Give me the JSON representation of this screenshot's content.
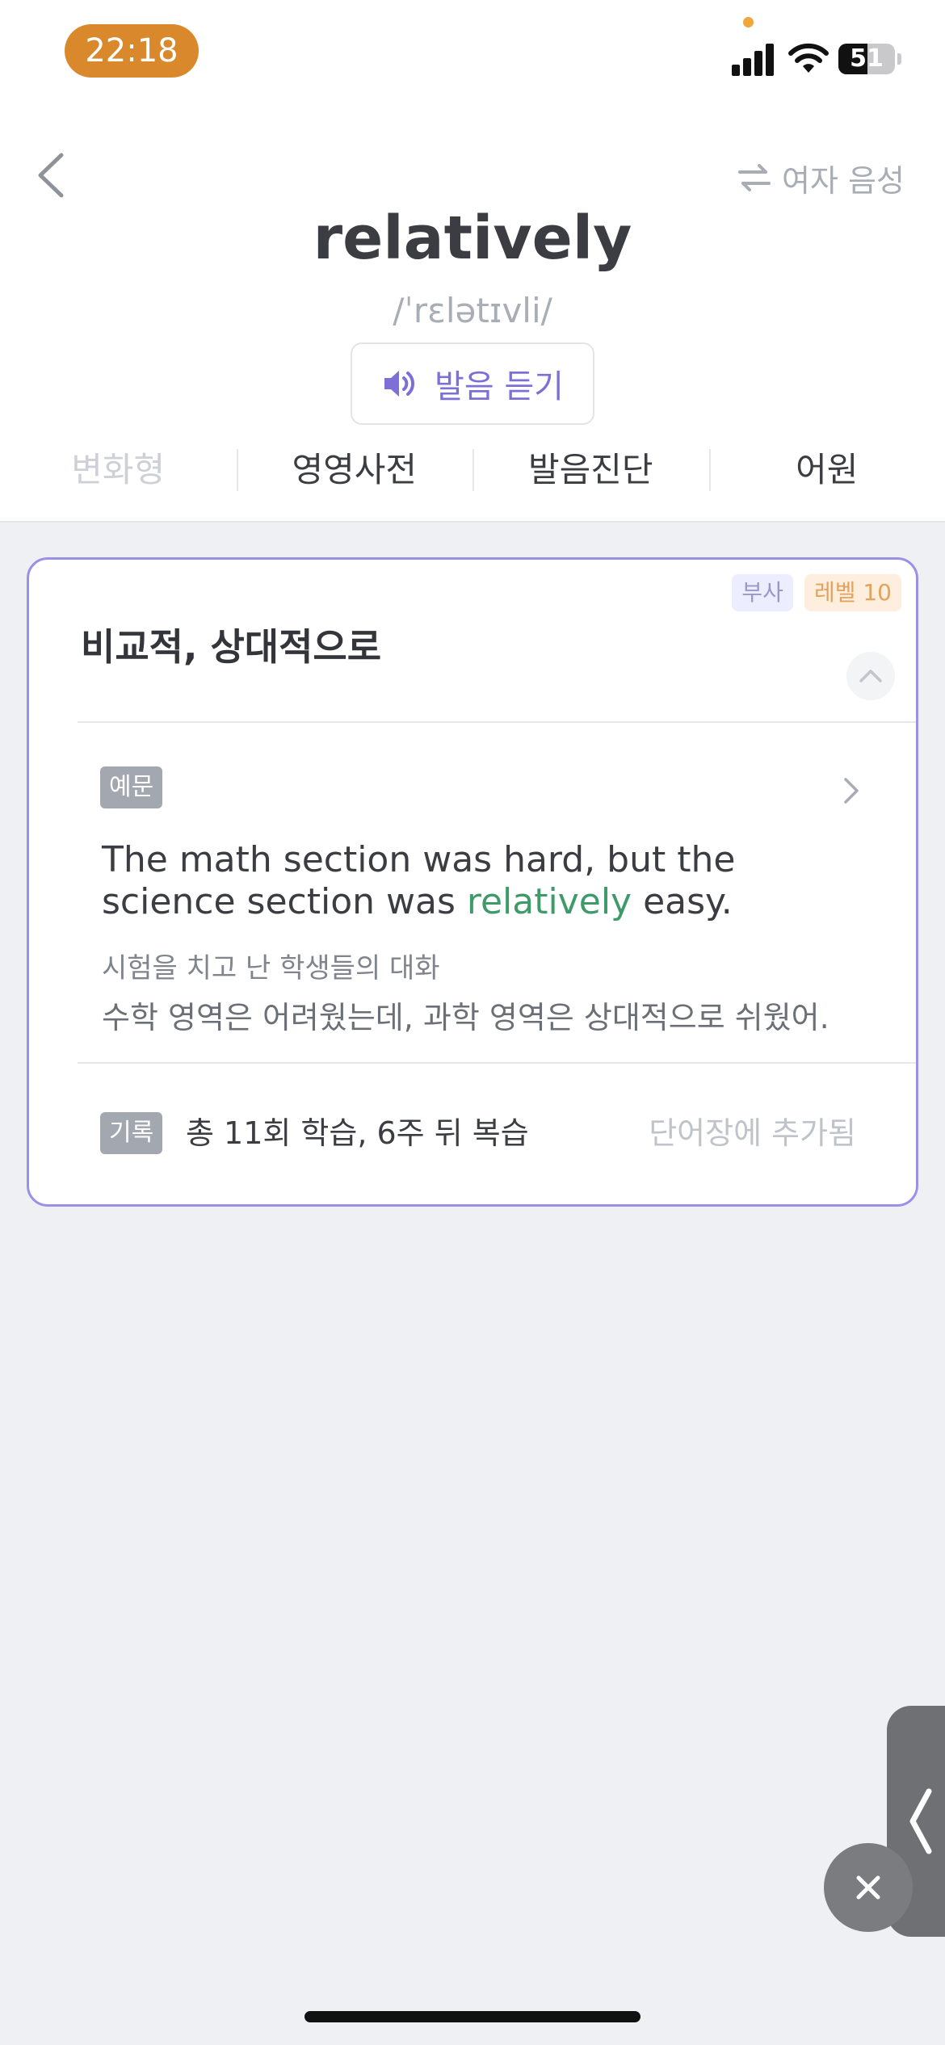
{
  "status_bar": {
    "time": "22:18",
    "battery_percent": "51",
    "icons": [
      "signal-icon",
      "wifi-icon",
      "battery-icon"
    ]
  },
  "header": {
    "back_icon": "chevron-left-icon",
    "voice_toggle_icon": "swap-arrows-icon",
    "voice_toggle_label": "여자 음성"
  },
  "word": {
    "text": "relatively",
    "phonetic": "/ˈrɛlətɪvli/",
    "listen_icon": "speaker-icon",
    "listen_label": "발음 듣기"
  },
  "tabs": [
    {
      "label": "변화형",
      "enabled": false
    },
    {
      "label": "영영사전",
      "enabled": true
    },
    {
      "label": "발음진단",
      "enabled": true
    },
    {
      "label": "어원",
      "enabled": true
    }
  ],
  "card": {
    "part_of_speech": "부사",
    "level": "레벨 10",
    "meaning": "비교적, 상대적으로",
    "collapse_icon": "chevron-up-icon",
    "example": {
      "tag": "예문",
      "sentence_before": "The math section was hard, but the science section was ",
      "highlight": "relatively",
      "sentence_after": " easy.",
      "context": "시험을 치고 난 학생들의 대화",
      "translation": "수학 영역은 어려웠는데, 과학 영역은 상대적으로 쉬웠어.",
      "arrow_icon": "chevron-right-icon"
    },
    "record": {
      "tag": "기록",
      "text": "총 11회 학습, 6주 뒤 복습",
      "status": "단어장에 추가됨"
    }
  },
  "floating": {
    "handle_icon": "chevron-left-icon",
    "close_icon": "close-icon"
  },
  "colors": {
    "accent_purple": "#7c6fd8",
    "card_border": "#9a90e6",
    "highlight_green": "#3e9a69",
    "time_pill": "#d9892b",
    "level_badge": "#e3a35e"
  }
}
